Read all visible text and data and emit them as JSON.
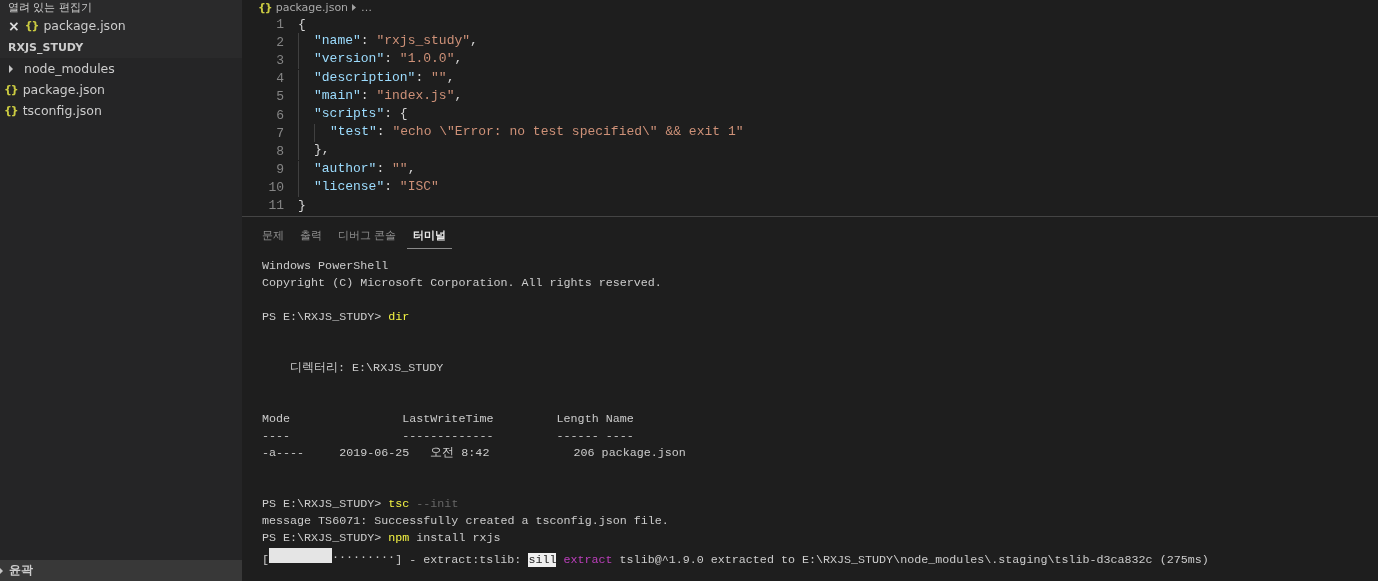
{
  "sidebar": {
    "open_editors_title": "열려 있는 편집기",
    "open_editors": [
      {
        "close": "×",
        "icon": "{}",
        "label": "package.json"
      }
    ],
    "folder_title": "RXJS_STUDY",
    "files": [
      {
        "kind": "folder",
        "label": "node_modules",
        "expanded": false
      },
      {
        "kind": "file",
        "icon": "{}",
        "label": "package.json"
      },
      {
        "kind": "file",
        "icon": "{}",
        "label": "tsconfig.json"
      }
    ],
    "outline_title": "윤곽"
  },
  "editor": {
    "breadcrumb": {
      "icon": "{}",
      "file": "package.json",
      "more": "…"
    },
    "lines": [
      {
        "number": "1",
        "tokens": [
          {
            "kind": "punct",
            "text": "{"
          }
        ],
        "children": [
          {
            "number": "2",
            "tokens": [
              {
                "kind": "key",
                "text": "\"name\""
              },
              {
                "kind": "punct",
                "text": ": "
              },
              {
                "kind": "string",
                "text": "\"rxjs_study\""
              },
              {
                "kind": "punct",
                "text": ","
              }
            ]
          },
          {
            "number": "3",
            "tokens": [
              {
                "kind": "key",
                "text": "\"version\""
              },
              {
                "kind": "punct",
                "text": ": "
              },
              {
                "kind": "string",
                "text": "\"1.0.0\""
              },
              {
                "kind": "punct",
                "text": ","
              }
            ]
          },
          {
            "number": "4",
            "tokens": [
              {
                "kind": "key",
                "text": "\"description\""
              },
              {
                "kind": "punct",
                "text": ": "
              },
              {
                "kind": "string",
                "text": "\"\""
              },
              {
                "kind": "punct",
                "text": ","
              }
            ]
          },
          {
            "number": "5",
            "tokens": [
              {
                "kind": "key",
                "text": "\"main\""
              },
              {
                "kind": "punct",
                "text": ": "
              },
              {
                "kind": "string",
                "text": "\"index.js\""
              },
              {
                "kind": "punct",
                "text": ","
              }
            ]
          },
          {
            "number": "6",
            "tokens": [
              {
                "kind": "key",
                "text": "\"scripts\""
              },
              {
                "kind": "punct",
                "text": ": {"
              }
            ],
            "children": [
              {
                "number": "7",
                "tokens": [
                  {
                    "kind": "key",
                    "text": "\"test\""
                  },
                  {
                    "kind": "punct",
                    "text": ": "
                  },
                  {
                    "kind": "string",
                    "text": "\"echo \\\"Error: no test specified\\\" && exit 1\""
                  }
                ]
              }
            ]
          },
          {
            "number": "8",
            "tokens": [
              {
                "kind": "punct",
                "text": "},"
              }
            ]
          },
          {
            "number": "9",
            "tokens": [
              {
                "kind": "key",
                "text": "\"author\""
              },
              {
                "kind": "punct",
                "text": ": "
              },
              {
                "kind": "string",
                "text": "\"\""
              },
              {
                "kind": "punct",
                "text": ","
              }
            ]
          },
          {
            "number": "10",
            "tokens": [
              {
                "kind": "key",
                "text": "\"license\""
              },
              {
                "kind": "punct",
                "text": ": "
              },
              {
                "kind": "string",
                "text": "\"ISC\""
              }
            ]
          }
        ]
      },
      {
        "number": "11",
        "tokens": [
          {
            "kind": "punct",
            "text": "}"
          }
        ]
      }
    ]
  },
  "panel": {
    "tabs": [
      {
        "label": "문제",
        "selected": false
      },
      {
        "label": "출력",
        "selected": false
      },
      {
        "label": "디버그 콘솔",
        "selected": false
      },
      {
        "label": "터미널",
        "selected": true
      }
    ],
    "terminal": [
      {
        "kind": "text",
        "segments": [
          {
            "kind": "plain",
            "text": "Windows PowerShell"
          }
        ]
      },
      {
        "kind": "text",
        "segments": [
          {
            "kind": "plain",
            "text": "Copyright (C) Microsoft Corporation. All rights reserved."
          }
        ]
      },
      {
        "kind": "blank"
      },
      {
        "kind": "text",
        "segments": [
          {
            "kind": "plain",
            "text": "PS E:\\RXJS_STUDY> "
          },
          {
            "kind": "command",
            "text": "dir"
          }
        ]
      },
      {
        "kind": "blank"
      },
      {
        "kind": "blank"
      },
      {
        "kind": "text",
        "segments": [
          {
            "kind": "plain",
            "text": "    디렉터리: E:\\RXJS_STUDY"
          }
        ]
      },
      {
        "kind": "blank"
      },
      {
        "kind": "blank"
      },
      {
        "kind": "text",
        "segments": [
          {
            "kind": "plain",
            "text": "Mode                LastWriteTime         Length Name"
          }
        ]
      },
      {
        "kind": "text",
        "segments": [
          {
            "kind": "plain",
            "text": "----                -------------         ------ ----"
          }
        ]
      },
      {
        "kind": "text",
        "segments": [
          {
            "kind": "plain",
            "text": "-a----     2019-06-25   오전 8:42            206 package.json"
          }
        ]
      },
      {
        "kind": "blank"
      },
      {
        "kind": "blank"
      },
      {
        "kind": "text",
        "segments": [
          {
            "kind": "plain",
            "text": "PS E:\\RXJS_STUDY> "
          },
          {
            "kind": "command",
            "text": "tsc"
          },
          {
            "kind": "dim",
            "text": " --init"
          }
        ]
      },
      {
        "kind": "text",
        "segments": [
          {
            "kind": "plain",
            "text": "message TS6071: Successfully created a tsconfig.json file."
          }
        ]
      },
      {
        "kind": "text",
        "segments": [
          {
            "kind": "plain",
            "text": "PS E:\\RXJS_STUDY> "
          },
          {
            "kind": "command",
            "text": "npm"
          },
          {
            "kind": "plain",
            "text": " install rxjs"
          }
        ]
      },
      {
        "kind": "text",
        "segments": [
          {
            "kind": "plain",
            "text": "["
          },
          {
            "kind": "progress",
            "level": 0.5,
            "text": "........."
          },
          {
            "kind": "plain",
            "text": "] - extract:tslib: "
          },
          {
            "kind": "inverse",
            "text": "sill"
          },
          {
            "kind": "magenta",
            "text": " extract"
          },
          {
            "kind": "plain",
            "text": " tslib@^1.9.0 extracted to E:\\RXJS_STUDY\\node_modules\\.staging\\tslib-d3ca832c (275ms)"
          }
        ]
      }
    ]
  }
}
